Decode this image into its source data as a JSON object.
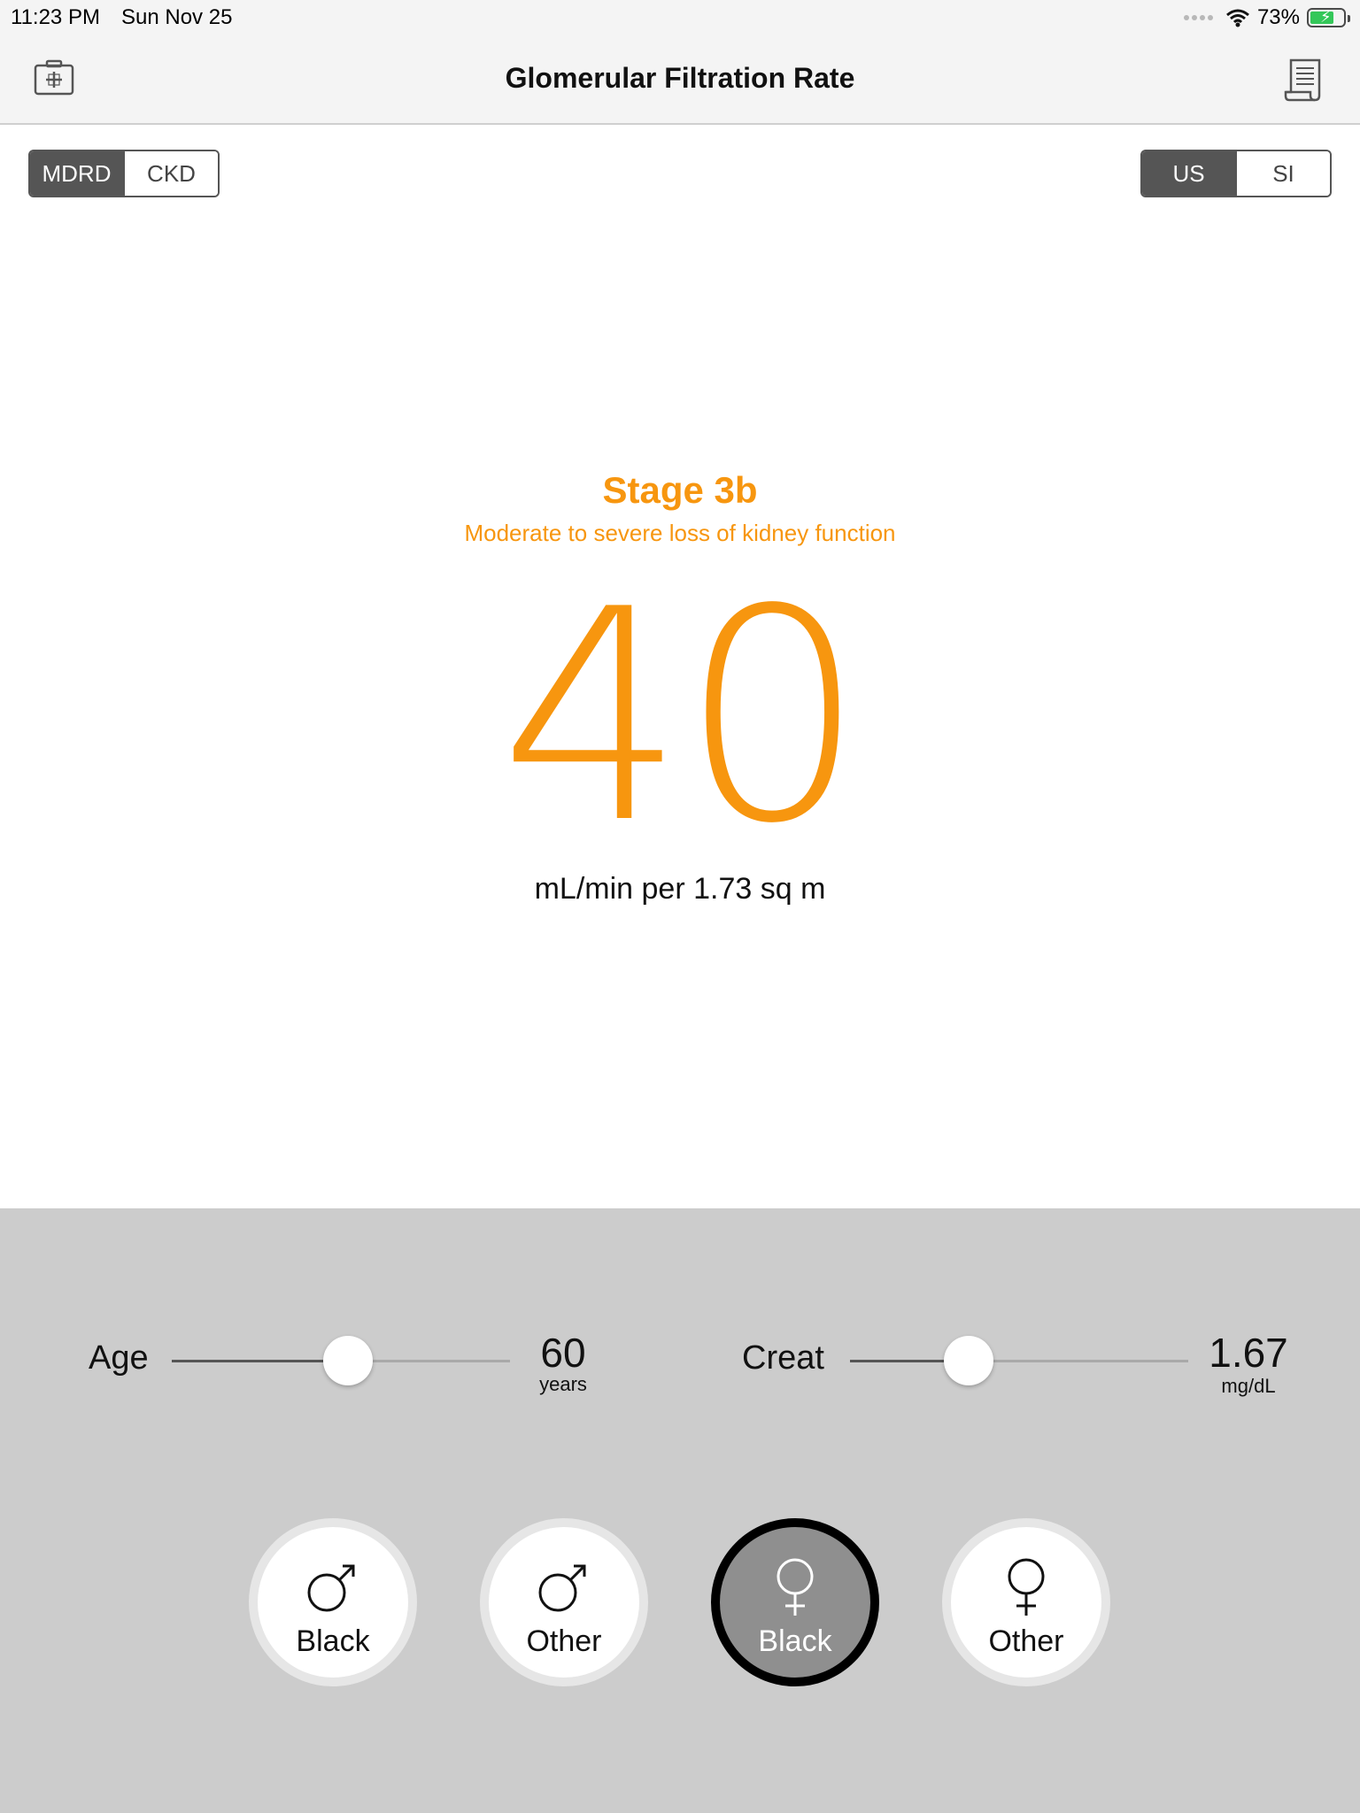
{
  "status": {
    "time": "11:23 PM",
    "date": "Sun Nov 25",
    "battery": "73%"
  },
  "nav": {
    "title": "Glomerular Filtration Rate",
    "left_icon": "medical-kit-icon",
    "right_icon": "document-scroll-icon"
  },
  "formula": {
    "options": [
      "MDRD",
      "CKD"
    ],
    "selected": "MDRD"
  },
  "units": {
    "options": [
      "US",
      "SI"
    ],
    "selected": "US"
  },
  "result": {
    "stage": "Stage 3b",
    "description": "Moderate to severe loss of kidney function",
    "value": "40",
    "unit": "mL/min per 1.73 sq m",
    "color": "#f7960f"
  },
  "age": {
    "label": "Age",
    "value": "60",
    "unit": "years",
    "slider_fraction": 0.52
  },
  "creat": {
    "label": "Creat",
    "value": "1.67",
    "unit": "mg/dL",
    "slider_fraction": 0.35
  },
  "patient_types": [
    {
      "sex": "male",
      "label": "Black",
      "icon": "male-symbol-icon",
      "selected": false
    },
    {
      "sex": "male",
      "label": "Other",
      "icon": "male-symbol-icon",
      "selected": false
    },
    {
      "sex": "female",
      "label": "Black",
      "icon": "female-symbol-icon",
      "selected": true
    },
    {
      "sex": "female",
      "label": "Other",
      "icon": "female-symbol-icon",
      "selected": false
    }
  ]
}
